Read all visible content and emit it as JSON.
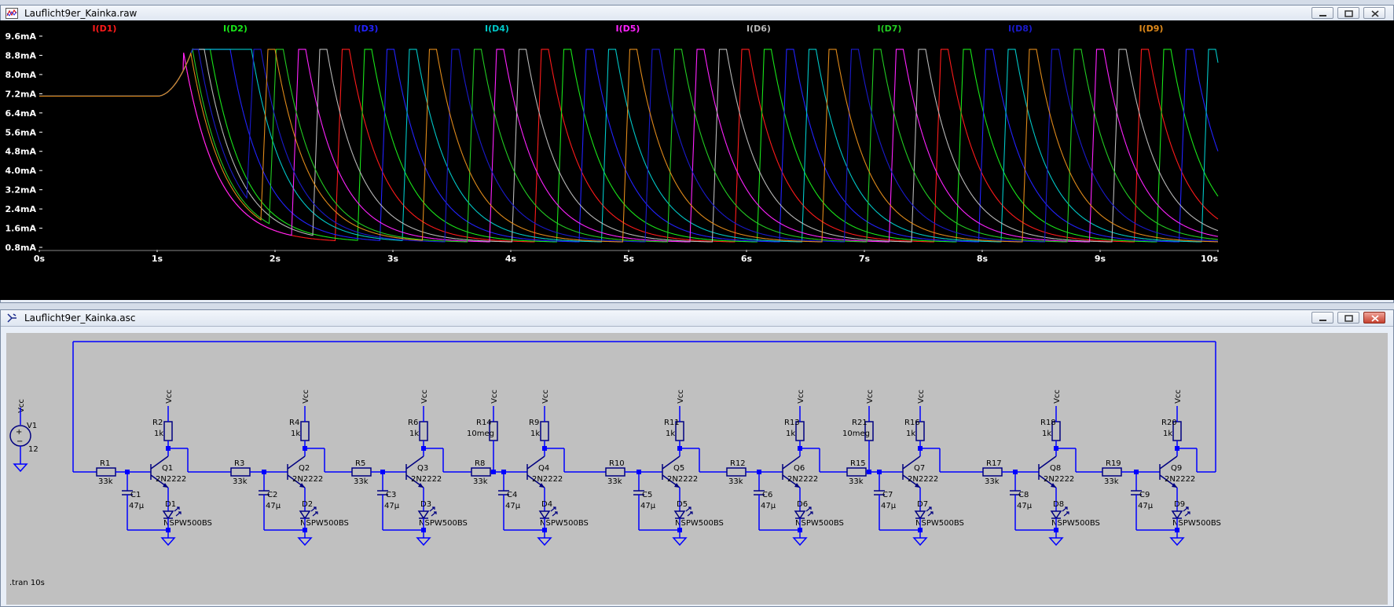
{
  "plot_window": {
    "title": "Lauflicht9er_Kainka.raw",
    "buttons": [
      "minimize",
      "restore",
      "close"
    ]
  },
  "schematic_window": {
    "title": "Lauflicht9er_Kainka.asc",
    "buttons": [
      "minimize",
      "restore",
      "close"
    ]
  },
  "chart_data": {
    "type": "line",
    "background": "#000000",
    "xlabel": "",
    "ylabel": "",
    "xlim": [
      0,
      10
    ],
    "ylim": [
      0.8,
      9.6
    ],
    "x_ticks": [
      "0s",
      "1s",
      "2s",
      "3s",
      "4s",
      "5s",
      "6s",
      "7s",
      "8s",
      "9s",
      "10s"
    ],
    "y_ticks": [
      "9.6mA",
      "8.8mA",
      "8.0mA",
      "7.2mA",
      "6.4mA",
      "5.6mA",
      "4.8mA",
      "4.0mA",
      "3.2mA",
      "2.4mA",
      "1.6mA",
      "0.8mA"
    ],
    "grid": false,
    "legend_position": "top",
    "description_of_waves": "All traces start at 7.1mA, diverge at about 1s, then cycle: sharp rise to 9.0mA followed by exponential decay toward ~1mA, repeating in a running-light sequence.",
    "series": [
      {
        "name": "I(D1)",
        "color": "#ff1a1a",
        "fall_times": [
          1.22,
          2.63,
          4.32,
          6.02,
          7.71,
          9.41
        ],
        "start_high": false
      },
      {
        "name": "I(D2)",
        "color": "#19e619",
        "fall_times": [
          1.45,
          2.82,
          4.51,
          6.21,
          7.9,
          9.6
        ],
        "start_high": false
      },
      {
        "name": "I(D3)",
        "color": "#2222ff",
        "fall_times": [
          1.62,
          3.01,
          4.7,
          6.4,
          8.09,
          9.79
        ],
        "start_high": false
      },
      {
        "name": "I(D4)",
        "color": "#00c8c8",
        "fall_times": [
          1.8,
          3.2,
          4.89,
          6.59,
          8.28,
          9.98
        ],
        "start_high": false
      },
      {
        "name": "I(D5)",
        "color": "#ff22ff",
        "fall_times": [
          1.22,
          2.26,
          3.94,
          5.64,
          7.33,
          9.03
        ],
        "start_high": false
      },
      {
        "name": "I(D6)",
        "color": "#b8b8b8",
        "fall_times": [
          1.4,
          2.44,
          4.13,
          5.83,
          7.52,
          9.22
        ],
        "start_high": false
      },
      {
        "name": "I(D7)",
        "color": "#22cc22",
        "fall_times": [
          1.3,
          2.07,
          3.75,
          5.45,
          7.14,
          8.84
        ],
        "start_high": false
      },
      {
        "name": "I(D8)",
        "color": "#1a1acc",
        "fall_times": [
          1.35,
          1.88,
          3.56,
          5.26,
          6.95,
          8.65
        ],
        "start_high": false
      },
      {
        "name": "I(D9)",
        "color": "#e08a1a",
        "fall_times": [
          1.28,
          2.0,
          3.37,
          5.07,
          6.76,
          8.46
        ],
        "start_high": false
      }
    ]
  },
  "schematic": {
    "wire_color": "#0000ff",
    "part_color": "#000080",
    "text_color": "#000000",
    "source": {
      "name": "V1",
      "value": "12",
      "net": "Vcc"
    },
    "directive": ".tran 10s",
    "vcc_label": "Vcc",
    "stages": [
      {
        "rb": "R1",
        "rb_val": "33k",
        "rc": "R2",
        "rc_val": "1k",
        "c": "C1",
        "c_val": "47µ",
        "q": "Q1",
        "q_model": "2N2222",
        "d": "D1",
        "d_model": "NSPW500BS",
        "extra_r": "",
        "extra_r_val": ""
      },
      {
        "rb": "R3",
        "rb_val": "33k",
        "rc": "R4",
        "rc_val": "1k",
        "c": "C2",
        "c_val": "47µ",
        "q": "Q2",
        "q_model": "2N2222",
        "d": "D2",
        "d_model": "NSPW500BS",
        "extra_r": "",
        "extra_r_val": ""
      },
      {
        "rb": "R5",
        "rb_val": "33k",
        "rc": "R6",
        "rc_val": "1k",
        "c": "C3",
        "c_val": "47µ",
        "q": "Q3",
        "q_model": "2N2222",
        "d": "D3",
        "d_model": "NSPW500BS",
        "extra_r": "",
        "extra_r_val": ""
      },
      {
        "rb": "R8",
        "rb_val": "33k",
        "rc": "R9",
        "rc_val": "1k",
        "c": "C4",
        "c_val": "47µ",
        "q": "Q4",
        "q_model": "2N2222",
        "d": "D4",
        "d_model": "NSPW500BS",
        "extra_r": "R14",
        "extra_r_val": "10meg"
      },
      {
        "rb": "R10",
        "rb_val": "33k",
        "rc": "R11",
        "rc_val": "1k",
        "c": "C5",
        "c_val": "47µ",
        "q": "Q5",
        "q_model": "2N2222",
        "d": "D5",
        "d_model": "NSPW500BS",
        "extra_r": "",
        "extra_r_val": ""
      },
      {
        "rb": "R12",
        "rb_val": "33k",
        "rc": "R13",
        "rc_val": "1k",
        "c": "C6",
        "c_val": "47µ",
        "q": "Q6",
        "q_model": "2N2222",
        "d": "D6",
        "d_model": "NSPW500BS",
        "extra_r": "",
        "extra_r_val": ""
      },
      {
        "rb": "R15",
        "rb_val": "33k",
        "rc": "R16",
        "rc_val": "1k",
        "c": "C7",
        "c_val": "47µ",
        "q": "Q7",
        "q_model": "2N2222",
        "d": "D7",
        "d_model": "NSPW500BS",
        "extra_r": "R21",
        "extra_r_val": "10meg"
      },
      {
        "rb": "R17",
        "rb_val": "33k",
        "rc": "R18",
        "rc_val": "1k",
        "c": "C8",
        "c_val": "47µ",
        "q": "Q8",
        "q_model": "2N2222",
        "d": "D8",
        "d_model": "NSPW500BS",
        "extra_r": "",
        "extra_r_val": ""
      },
      {
        "rb": "R19",
        "rb_val": "33k",
        "rc": "R20",
        "rc_val": "1k",
        "c": "C9",
        "c_val": "47µ",
        "q": "Q9",
        "q_model": "2N2222",
        "d": "D9",
        "d_model": "NSPW500BS",
        "extra_r": "",
        "extra_r_val": ""
      }
    ]
  }
}
